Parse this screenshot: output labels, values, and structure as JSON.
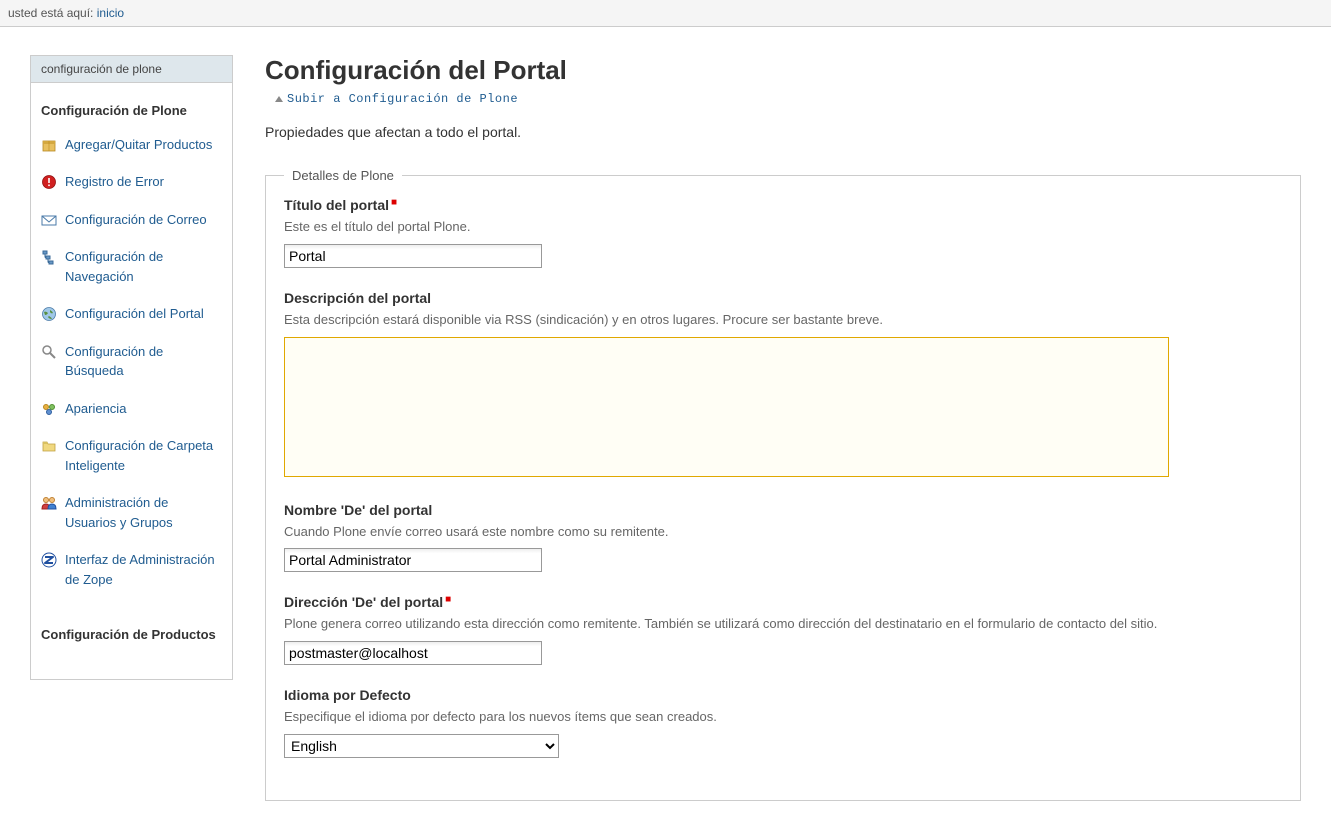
{
  "breadcrumb": {
    "prefix": "usted está aquí: ",
    "link": "inicio"
  },
  "sidebar": {
    "header": "configuración de plone",
    "section1_title": "Configuración de Plone",
    "items": [
      {
        "label": "Agregar/Quitar Productos",
        "icon": "box"
      },
      {
        "label": "Registro de Error",
        "icon": "error"
      },
      {
        "label": "Configuración de Correo",
        "icon": "mail"
      },
      {
        "label": "Configuración de Navegación",
        "icon": "nav"
      },
      {
        "label": "Configuración del Portal",
        "icon": "world"
      },
      {
        "label": "Configuración de Búsqueda",
        "icon": "search"
      },
      {
        "label": "Apariencia",
        "icon": "theme"
      },
      {
        "label": "Configuración de Carpeta Inteligente",
        "icon": "folder"
      },
      {
        "label": "Administración de Usuarios y Grupos",
        "icon": "users"
      },
      {
        "label": "Interfaz de Administración de Zope",
        "icon": "zope"
      }
    ],
    "section2_title": "Configuración de Productos"
  },
  "main": {
    "title": "Configuración del Portal",
    "up_link": "Subir a Configuración de Plone",
    "description": "Propiedades que afectan a todo el portal.",
    "fieldset_legend": "Detalles de Plone",
    "fields": {
      "site_title": {
        "label": "Título del portal",
        "required": true,
        "help": "Este es el título del portal Plone.",
        "value": "Portal"
      },
      "site_description": {
        "label": "Descripción del portal",
        "required": false,
        "help": "Esta descripción estará disponible via RSS (sindicación) y en otros lugares. Procure ser bastante breve.",
        "value": ""
      },
      "from_name": {
        "label": "Nombre 'De' del portal",
        "required": false,
        "help": "Cuando Plone envíe correo usará este nombre como su remitente.",
        "value": "Portal Administrator"
      },
      "from_address": {
        "label": "Dirección 'De' del portal",
        "required": true,
        "help": "Plone genera correo utilizando esta dirección como remitente. También se utilizará como dirección del destinatario en el formulario de contacto del sitio.",
        "value": "postmaster@localhost"
      },
      "default_language": {
        "label": "Idioma por Defecto",
        "required": false,
        "help": "Especifique el idioma por defecto para los nuevos ítems que sean creados.",
        "value": "English"
      }
    }
  }
}
